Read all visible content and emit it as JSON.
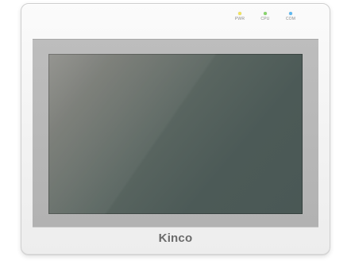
{
  "device": {
    "brand_label": "Kinco",
    "indicators": [
      {
        "label": "PWR",
        "color": "#f2e35a"
      },
      {
        "label": "CPU",
        "color": "#86d46a"
      },
      {
        "label": "COM",
        "color": "#5ab8f2"
      }
    ]
  }
}
